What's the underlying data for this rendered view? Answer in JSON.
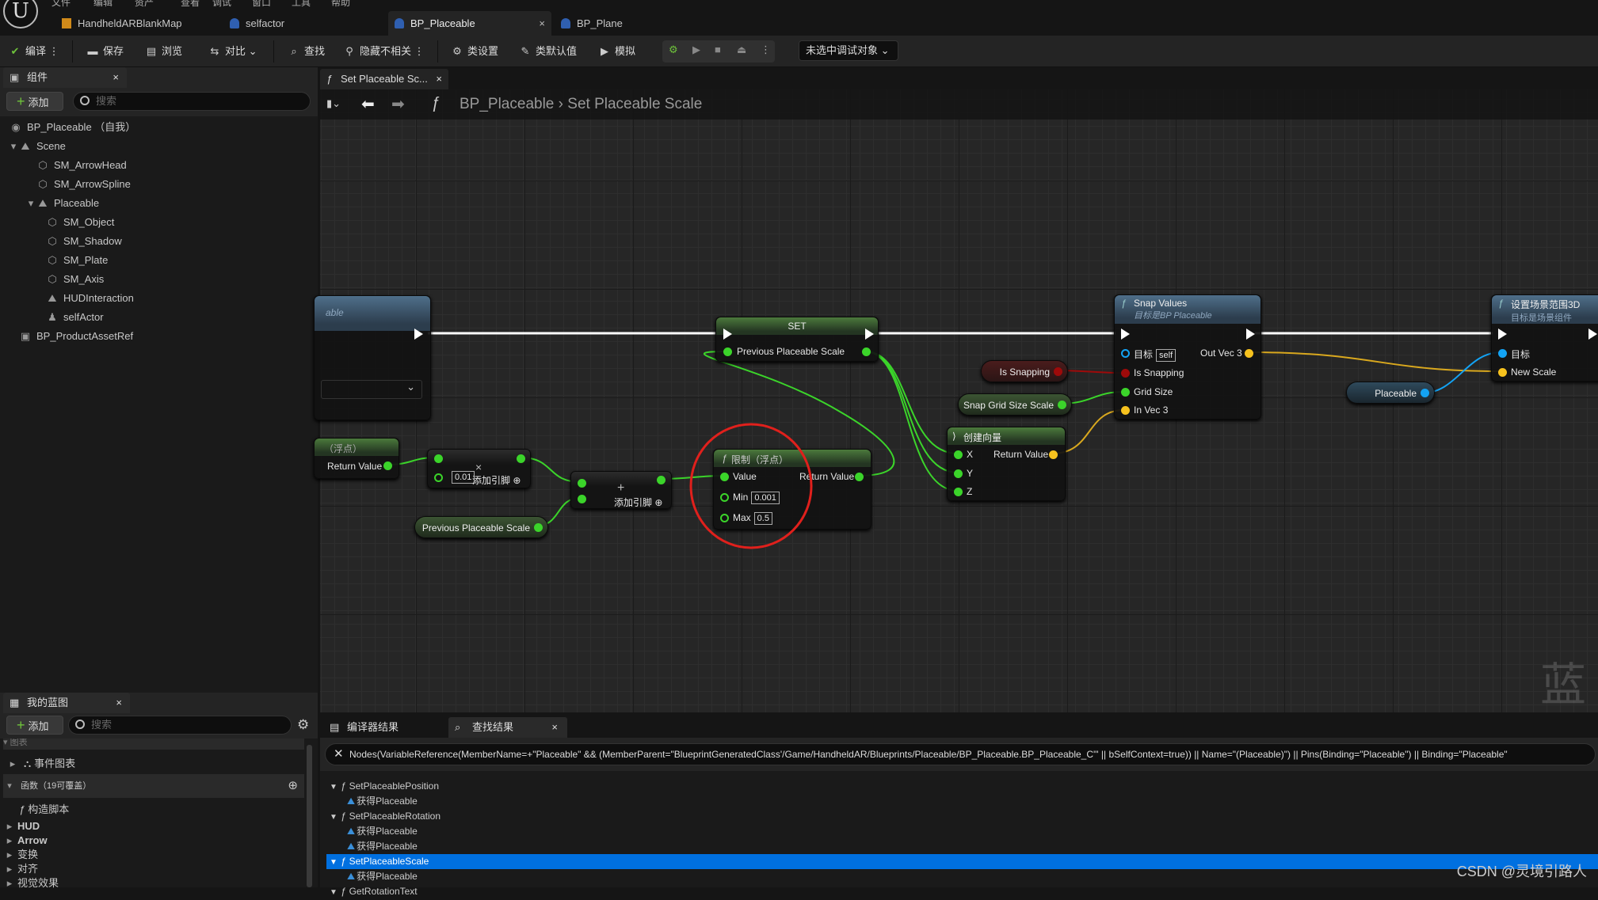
{
  "menu": [
    "文件",
    "编辑",
    "资产",
    "查看",
    "调试",
    "窗口",
    "工具",
    "帮助"
  ],
  "doc_tabs": [
    {
      "label": "HandheldARBlankMap",
      "icon": "level-icon"
    },
    {
      "label": "selfactor",
      "icon": "blueprint-icon"
    },
    {
      "label": "BP_Placeable",
      "icon": "blueprint-icon",
      "active": true,
      "close": "×"
    },
    {
      "label": "BP_Plane",
      "icon": "blueprint-icon"
    }
  ],
  "toolbar": {
    "compile": "编译",
    "save": "保存",
    "browse": "浏览",
    "diff": "对比",
    "find": "查找",
    "hide_unrelated": "隐藏不相关",
    "class_settings": "类设置",
    "class_defaults": "类默认值",
    "simulate": "模拟",
    "debug_target": "未选中调试对象"
  },
  "components": {
    "title": "组件",
    "close": "×",
    "add": "添加",
    "search_placeholder": "搜索",
    "tree": [
      {
        "label": "BP_Placeable （自我）",
        "depth": 0
      },
      {
        "label": "Scene",
        "depth": 1
      },
      {
        "label": "SM_ArrowHead",
        "depth": 2
      },
      {
        "label": "SM_ArrowSpline",
        "depth": 2
      },
      {
        "label": "Placeable",
        "depth": 2
      },
      {
        "label": "SM_Object",
        "depth": 3
      },
      {
        "label": "SM_Shadow",
        "depth": 3
      },
      {
        "label": "SM_Plate",
        "depth": 3
      },
      {
        "label": "SM_Axis",
        "depth": 3
      },
      {
        "label": "HUDInteraction",
        "depth": 3
      },
      {
        "label": "selfActor",
        "depth": 3
      },
      {
        "label": "BP_ProductAssetRef",
        "depth": 1
      }
    ]
  },
  "my_blueprint": {
    "title": "我的蓝图",
    "close": "×",
    "add": "添加",
    "search_placeholder": "搜索",
    "graphs_header": "图表",
    "event_graph": "事件图表",
    "functions_header": "函数（19可覆盖）",
    "construction_script": "构造脚本",
    "categories": [
      "HUD",
      "Arrow",
      "变换",
      "对齐",
      "视觉效果"
    ]
  },
  "graph": {
    "tab": "Set Placeable Sc...",
    "tab_close": "×",
    "breadcrumb": [
      "BP_Placeable",
      "Set Placeable Scale"
    ],
    "nodes": {
      "entry_partial": {
        "title": "able"
      },
      "set": {
        "title": "SET",
        "pin": "Previous Placeable Scale"
      },
      "snap": {
        "title": "Snap Values",
        "subtitle": "目标是BP Placeable",
        "target": "目标",
        "target_value": "self",
        "is_snapping": "Is Snapping",
        "grid_size": "Grid Size",
        "in_vec": "In Vec 3",
        "out_vec": "Out Vec 3"
      },
      "set_scale": {
        "title": "设置场景范围3D",
        "subtitle": "目标是场景组件",
        "target": "目标",
        "new_scale": "New Scale"
      },
      "is_snapping_var": "Is Snapping",
      "snap_grid_var": "Snap Grid Size Scale",
      "placeable_var": "Placeable",
      "make_vector": {
        "title": "创建向量",
        "x": "X",
        "y": "Y",
        "z": "Z",
        "ret": "Return Value"
      },
      "float_partial": {
        "title": "（浮点）",
        "ret": "Return Value"
      },
      "multiply": {
        "value": "0.01",
        "add_pin": "添加引脚",
        "symbol": "×"
      },
      "add": {
        "add_pin": "添加引脚",
        "symbol": "+"
      },
      "prev_scale_var": "Previous Placeable Scale",
      "clamp": {
        "title": "限制（浮点）",
        "value": "Value",
        "ret": "Return Value",
        "min": "Min",
        "min_value": "0.001",
        "max": "Max",
        "max_value": "0.5"
      }
    },
    "watermark": "蓝"
  },
  "bottom": {
    "tabs": [
      {
        "label": "编译器结果"
      },
      {
        "label": "查找结果",
        "close": "×"
      }
    ],
    "query": "Nodes(VariableReference(MemberName=+\"Placeable\" && (MemberParent=\"BlueprintGeneratedClass'/Game/HandheldAR/Blueprints/Placeable/BP_Placeable.BP_Placeable_C'\" || bSelfContext=true)) || Name=\"(Placeable)\") || Pins(Binding=\"Placeable\") || Binding=\"Placeable\"",
    "results": [
      {
        "label": "SetPlaceablePosition",
        "type": "function"
      },
      {
        "label": "获得Placeable",
        "type": "get"
      },
      {
        "label": "SetPlaceableRotation",
        "type": "function"
      },
      {
        "label": "获得Placeable",
        "type": "get"
      },
      {
        "label": "获得Placeable",
        "type": "get"
      },
      {
        "label": "SetPlaceableScale",
        "type": "function",
        "selected": true
      },
      {
        "label": "获得Placeable",
        "type": "get"
      },
      {
        "label": "GetRotationText",
        "type": "function"
      }
    ]
  },
  "watermark": "CSDN @灵境引路人",
  "colors": {
    "float_pin": "#3bd42a",
    "bool_pin": "#9e0a0a",
    "vector_pin": "#f7c21e",
    "object_pin": "#13a3f4",
    "selection": "#0070e0",
    "annotation": "#e0201c"
  }
}
